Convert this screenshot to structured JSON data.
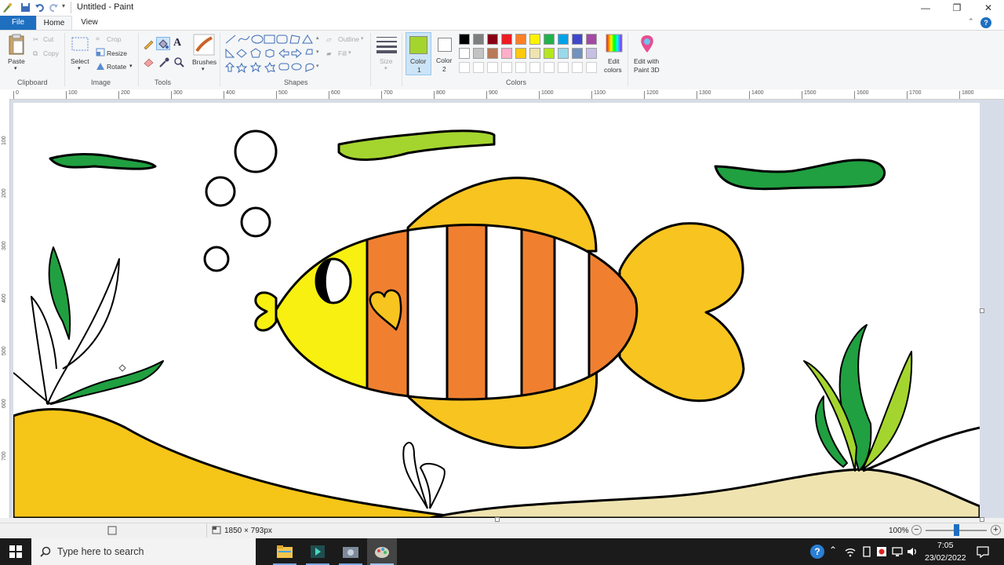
{
  "window": {
    "title": "Untitled - Paint"
  },
  "tabs": {
    "file": "File",
    "home": "Home",
    "view": "View"
  },
  "clipboard": {
    "paste": "Paste",
    "cut": "Cut",
    "copy": "Copy",
    "label": "Clipboard"
  },
  "image": {
    "select": "Select",
    "crop": "Crop",
    "resize": "Resize",
    "rotate": "Rotate",
    "label": "Image"
  },
  "tools": {
    "brushes": "Brushes",
    "label": "Tools"
  },
  "shapes": {
    "outline": "Outline",
    "fill": "Fill",
    "label": "Shapes"
  },
  "size": {
    "label": "Size"
  },
  "colors": {
    "color1_label": "Color",
    "color1_num": "1",
    "color2_label": "Color",
    "color2_num": "2",
    "edit_line1": "Edit",
    "edit_line2": "colors",
    "paint3d_line1": "Edit with",
    "paint3d_line2": "Paint 3D",
    "label": "Colors",
    "color1_value": "#a4d52e",
    "color2_value": "#ffffff",
    "palette_row1": [
      "#000000",
      "#7f7f7f",
      "#880015",
      "#ed1c24",
      "#ff7f27",
      "#fff200",
      "#22b14c",
      "#00a2e8",
      "#3f48cc",
      "#a349a4"
    ],
    "palette_row2": [
      "#ffffff",
      "#c3c3c3",
      "#b97a57",
      "#ffaec9",
      "#ffc90e",
      "#efe4b0",
      "#b5e61d",
      "#99d9ea",
      "#7092be",
      "#c8bfe7"
    ]
  },
  "ruler": {
    "h_ticks": [
      "0",
      "100",
      "200",
      "300",
      "400",
      "500",
      "600",
      "700",
      "800",
      "900",
      "1000",
      "1100",
      "1200",
      "1300",
      "1400",
      "1500",
      "1600",
      "1700",
      "1800"
    ],
    "v_ticks": [
      "100",
      "200",
      "300",
      "400",
      "500",
      "600",
      "700"
    ]
  },
  "status": {
    "dimensions": "1850 × 793px",
    "zoom": "100%",
    "zoom_level": 0.5
  },
  "taskbar": {
    "search_placeholder": "Type here to search",
    "time": "7:05",
    "date": "23/02/2022"
  },
  "drawing": {
    "fish_body_yellow": "#f8f010",
    "fish_orange": "#f08030",
    "fish_fin": "#f8c420",
    "seaweed_green": "#20a040",
    "seaweed_light": "#a4d52e",
    "sand_dark": "#f5c518",
    "sand_light": "#efe4b0"
  }
}
